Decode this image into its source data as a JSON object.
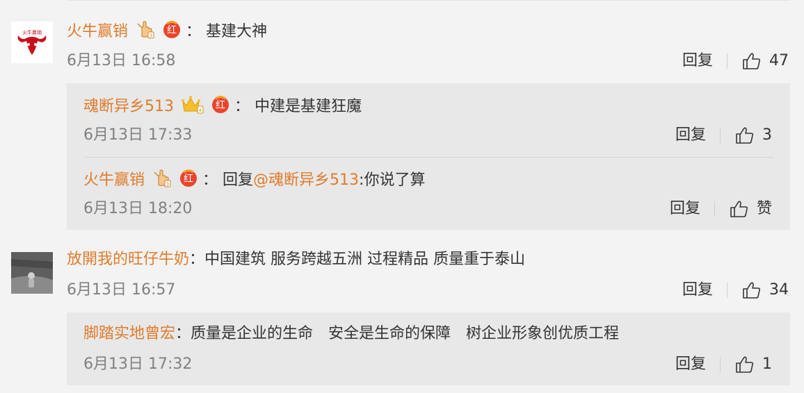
{
  "comments": [
    {
      "user": "火牛赢销",
      "sep": "：",
      "text": "基建大神",
      "time": "6月13日 16:58",
      "reply": "回复",
      "likes": "47",
      "avatar_text": "火牛赢销",
      "replies": [
        {
          "user": "魂断异乡513",
          "sep": "：",
          "text": "中建是基建狂魔",
          "time": "6月13日 17:33",
          "reply": "回复",
          "likes": "3"
        },
        {
          "user": "火牛赢销",
          "sep": "：",
          "prefix": "回复",
          "mention": "@魂断异乡513",
          "text": ":你说了算",
          "time": "6月13日 18:20",
          "reply": "回复",
          "likes": "赞"
        }
      ]
    },
    {
      "user": "放開我的旺仔牛奶",
      "sep": "：",
      "text": "中国建筑 服务跨越五洲 过程精品 质量重于泰山",
      "time": "6月13日 16:57",
      "reply": "回复",
      "likes": "34",
      "replies": [
        {
          "user": "脚踏实地曾宏",
          "sep": "：",
          "text": "质量是企业的生命　安全是生命的保障　树企业形象创优质工程",
          "time": "6月13日 17:32",
          "reply": "回复",
          "likes": "1"
        }
      ]
    }
  ],
  "badges": {
    "red_label": "红"
  },
  "colors": {
    "username": "#e07b2a",
    "timestamp": "#808080",
    "reply_bg": "#e8e8e8",
    "page_bg": "#f3f3f3",
    "badge_red": "#e8452c"
  }
}
